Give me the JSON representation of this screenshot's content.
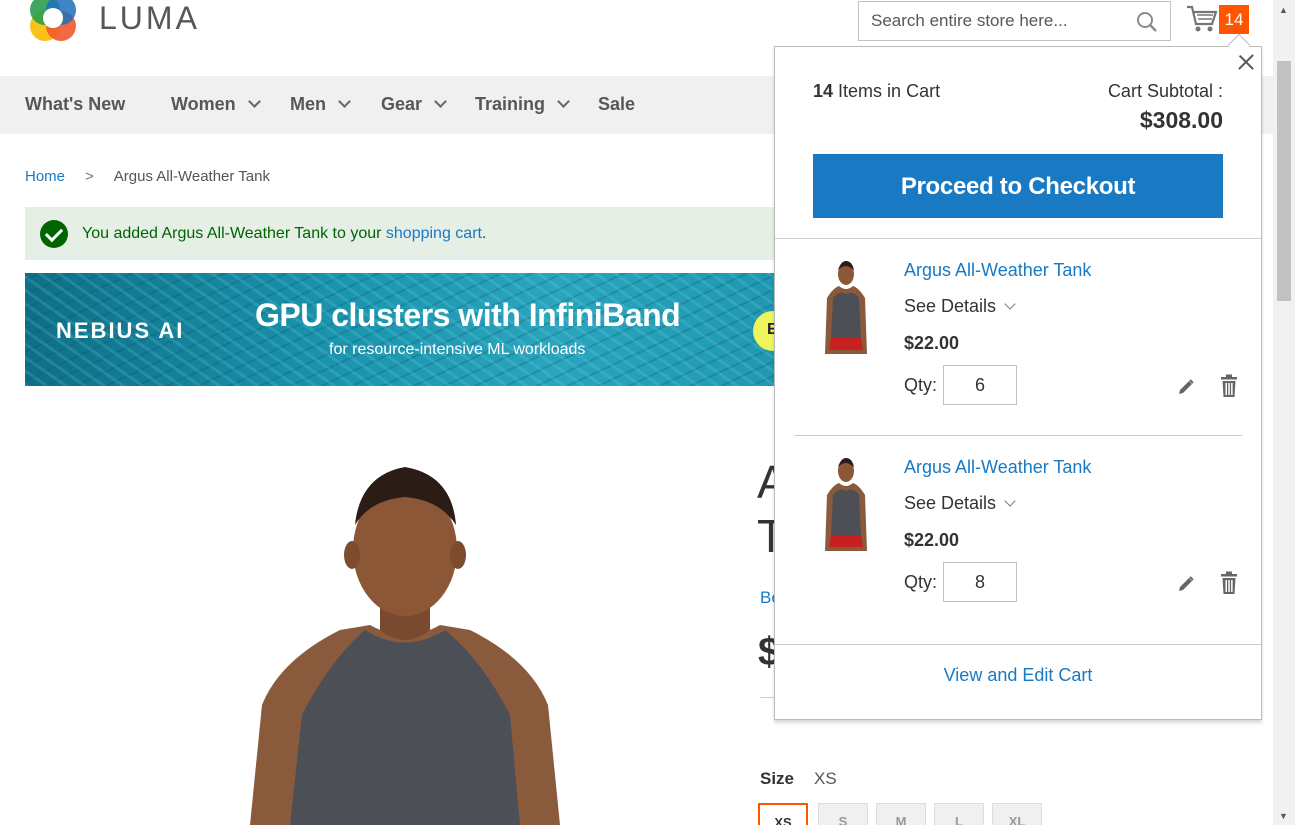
{
  "header": {
    "logo_text": "LUMA",
    "search_placeholder": "Search entire store here...",
    "cart_count": "14"
  },
  "nav": {
    "items": [
      {
        "label": "What's New",
        "dropdown": false
      },
      {
        "label": "Women",
        "dropdown": true
      },
      {
        "label": "Men",
        "dropdown": true
      },
      {
        "label": "Gear",
        "dropdown": true
      },
      {
        "label": "Training",
        "dropdown": true
      },
      {
        "label": "Sale",
        "dropdown": false
      }
    ]
  },
  "breadcrumb": {
    "home": "Home",
    "separator": ">",
    "current": "Argus All-Weather Tank"
  },
  "message": {
    "text_before": "You added Argus All-Weather Tank to your ",
    "link": "shopping cart",
    "text_after": "."
  },
  "ad": {
    "brand": "NEBIUS AI",
    "title": "GPU clusters with InfiniBand",
    "subtitle": "for resource-intensive ML workloads",
    "button_label": "E"
  },
  "product": {
    "title_line1": "A",
    "title_line2": "T",
    "reviews_link": "Be",
    "price": "$",
    "size_label": "Size",
    "size_selected": "XS",
    "sizes": [
      "XS",
      "S",
      "M",
      "L",
      "XL"
    ]
  },
  "minicart": {
    "count": "14",
    "count_label": "Items in Cart",
    "subtotal_label": "Cart Subtotal :",
    "subtotal_value": "$308.00",
    "checkout_label": "Proceed to Checkout",
    "items": [
      {
        "name": "Argus All-Weather Tank",
        "details": "See Details",
        "price": "$22.00",
        "qty_label": "Qty:",
        "qty": "6"
      },
      {
        "name": "Argus All-Weather Tank",
        "details": "See Details",
        "price": "$22.00",
        "qty_label": "Qty:",
        "qty": "8"
      }
    ],
    "view_cart_label": "View and Edit Cart"
  },
  "colors": {
    "accent_blue": "#1979c3",
    "cart_badge": "#ff5501",
    "success_bg": "#e5efe5",
    "success_text": "#006400"
  }
}
